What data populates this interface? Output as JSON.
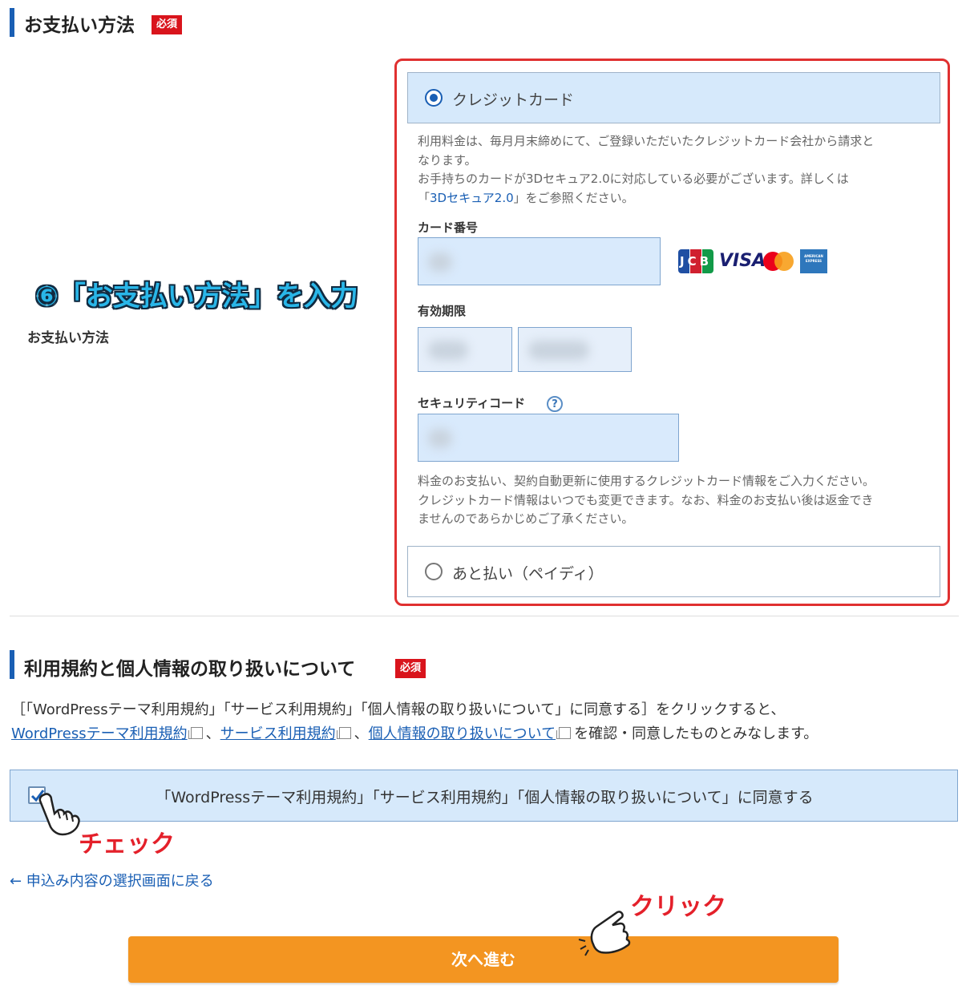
{
  "payment_section": {
    "title": "お支払い方法",
    "required_badge": "必須",
    "side_label": "お支払い方法",
    "annotation": "⑥「お支払い方法」を入力",
    "options": [
      {
        "label": "クレジットカード",
        "selected": true
      },
      {
        "label": "あと払い（ペイディ）",
        "selected": false
      }
    ],
    "credit_note": {
      "line1": "利用料金は、毎月月末締めにて、ご登録いただいたクレジットカード会社から請求と",
      "line2": "なります。",
      "line3": "お手持ちのカードが3Dセキュア2.0に対応している必要がございます。詳しくは",
      "line4_prefix": "「",
      "line4_link": "3Dセキュア2.0",
      "line4_suffix": "」をご参照ください。"
    },
    "card_number_label": "カード番号",
    "card_brands": [
      "JCB",
      "VISA",
      "Mastercard",
      "AMERICAN EXPRESS"
    ],
    "expiry_label": "有効期限",
    "security_label": "セキュリティコード",
    "help_icon": "?",
    "bottom_note": {
      "line1": "料金のお支払い、契約自動更新に使用するクレジットカード情報をご入力ください。",
      "line2": "クレジットカード情報はいつでも変更できます。なお、料金のお支払い後は返金でき",
      "line3": "ませんのであらかじめご了承ください。"
    }
  },
  "terms_section": {
    "title": "利用規約と個人情報の取り扱いについて",
    "required_badge": "必須",
    "line1": "［「WordPressテーマ利用規約」「サービス利用規約」「個人情報の取り扱いについて」に同意する］をクリックすると、",
    "link1": "WordPressテーマ利用規約",
    "sep1": "、",
    "link2": "サービス利用規約",
    "sep2": "、",
    "link3": "個人情報の取り扱いについて",
    "line2_suffix": "を確認・同意したものとみなします。",
    "agree_label": "「WordPressテーマ利用規約」「サービス利用規約」「個人情報の取り扱いについて」に同意する",
    "agree_checked": true,
    "check_annotation": "チェック"
  },
  "back_link": "← 申込み内容の選択画面に戻る",
  "next_button": "次へ進む",
  "click_annotation": "クリック",
  "colors": {
    "accent": "#1a5fb4",
    "required": "#d9141c",
    "button": "#f39521",
    "annotation_red": "#e4202a",
    "annotation_blue": "#29b6e8"
  }
}
